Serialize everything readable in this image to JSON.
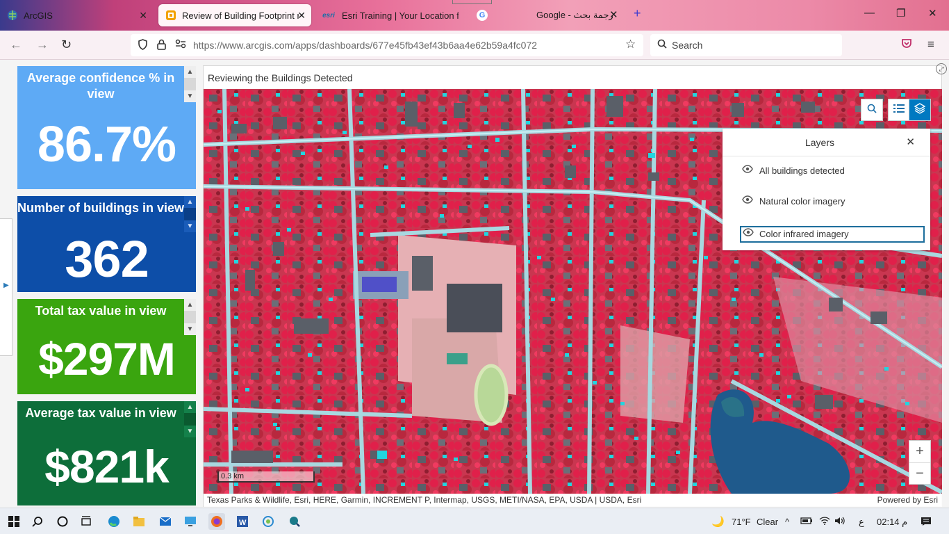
{
  "browser": {
    "tabs": [
      {
        "label": "ArcGIS",
        "icon": "globe-icon"
      },
      {
        "label": "Review of Building Footprint re",
        "icon": "dashboard-icon"
      },
      {
        "label": "Esri Training | Your Location for",
        "icon": "esri-icon",
        "icon_text": "esri"
      },
      {
        "label": "",
        "icon": "google-icon",
        "icon_text": "G"
      },
      {
        "label": "Google - ترجمة بحث",
        "icon": ""
      }
    ],
    "url": "https://www.arcgis.com/apps/dashboards/677e45fb43ef43b6aa4e62b59a4fc072",
    "search_placeholder": "Search"
  },
  "indicators": [
    {
      "title": "Average confidence % in view",
      "value": "86.7%",
      "color": "#5eaaf5"
    },
    {
      "title": "Number of buildings in view",
      "value": "362",
      "color": "#0d4ea8"
    },
    {
      "title": "Total tax value in view",
      "value": "$297M",
      "color": "#3aa50f"
    },
    {
      "title": "Average tax value in view",
      "value": "$821k",
      "color": "#0d6e3a"
    }
  ],
  "map": {
    "title": "Reviewing the Buildings Detected",
    "attribution": "Texas Parks & Wildlife, Esri, HERE, Garmin, INCREMENT P, Intermap, USGS, METI/NASA, EPA, USDA | USDA, Esri",
    "powered_by": "Powered by Esri",
    "scale": "0.3 km",
    "layers_panel": {
      "title": "Layers",
      "items": [
        {
          "label": "All buildings detected",
          "visible": true
        },
        {
          "label": "Natural color imagery",
          "visible": true
        },
        {
          "label": "Color infrared imagery",
          "visible": true
        }
      ]
    }
  },
  "taskbar": {
    "weather": "71°F",
    "condition": "Clear",
    "lang": "ع",
    "time": "02:14 م"
  }
}
